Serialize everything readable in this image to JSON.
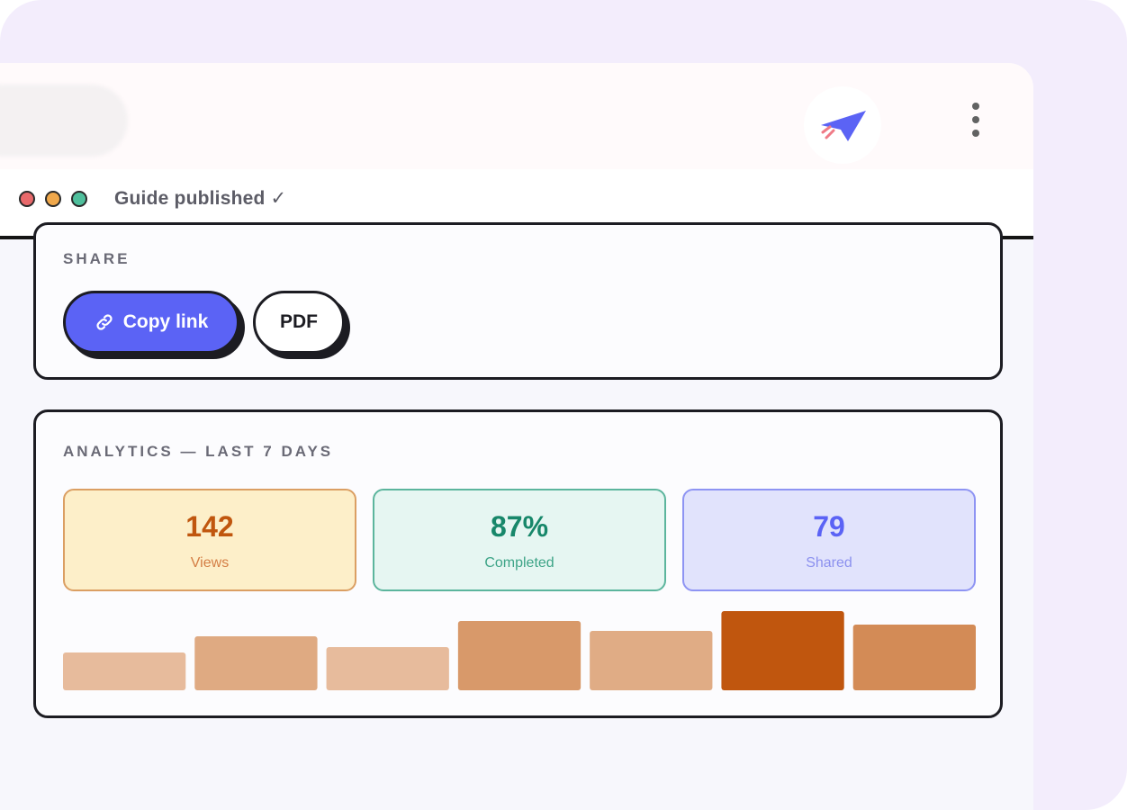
{
  "window": {
    "title": "Guide published ✓"
  },
  "browser": {
    "extension_icon": "paper-plane-icon",
    "menu_icon": "kebab-menu-icon"
  },
  "share": {
    "section_label": "SHARE",
    "copy_link_label": "Copy link",
    "copy_link_icon": "link-icon",
    "pdf_label": "PDF"
  },
  "analytics": {
    "section_label": "ANALYTICS — LAST 7 DAYS",
    "stats": [
      {
        "value": "142",
        "label": "Views"
      },
      {
        "value": "87%",
        "label": "Completed"
      },
      {
        "value": "79",
        "label": "Shared"
      }
    ]
  },
  "colors": {
    "accent": "#5b63f5",
    "views": "#c0560e",
    "completed": "#17876a",
    "shared": "#5b63f5"
  },
  "chart_data": {
    "type": "bar",
    "categories": [
      "",
      "",
      "",
      "",
      "",
      "",
      ""
    ],
    "values": [
      42,
      60,
      48,
      77,
      66,
      88,
      73
    ],
    "ylim": [
      0,
      90
    ],
    "grid": false,
    "bar_colors": [
      "#e7bb9c",
      "#dfaa82",
      "#e7bb9c",
      "#d8996a",
      "#e0ac85",
      "#c0560e",
      "#d38b56"
    ]
  }
}
